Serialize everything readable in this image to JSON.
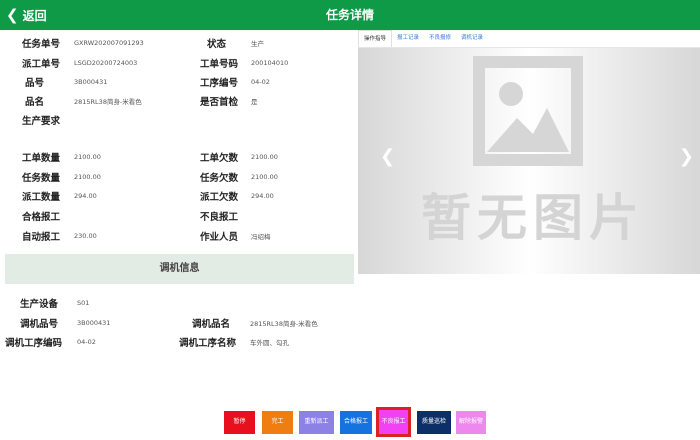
{
  "header": {
    "back_label": "返回",
    "title": "任务详情"
  },
  "fields": [
    {
      "label": "任务单号",
      "value": "GXRW202007091293"
    },
    {
      "label": "状态",
      "value": "生产"
    },
    {
      "label": "派工单号",
      "value": "LSGD20200724003"
    },
    {
      "label": "工单号码",
      "value": "200104010"
    },
    {
      "label": "品号",
      "value": "3B000431"
    },
    {
      "label": "工序编号",
      "value": "04-02"
    },
    {
      "label": "品名",
      "value": "2815RL38简身-米看色"
    },
    {
      "label": "是否首检",
      "value": "是"
    },
    {
      "label": "生产要求",
      "value": ""
    },
    {
      "label": "工单数量",
      "value": "2100.00"
    },
    {
      "label": "工单欠数",
      "value": "2100.00"
    },
    {
      "label": "任务数量",
      "value": "2100.00"
    },
    {
      "label": "任务欠数",
      "value": "2100.00"
    },
    {
      "label": "派工数量",
      "value": "294.00"
    },
    {
      "label": "派工欠数",
      "value": "294.00"
    },
    {
      "label": "合格报工",
      "value": ""
    },
    {
      "label": "不良报工",
      "value": ""
    },
    {
      "label": "自动报工",
      "value": "230.00"
    },
    {
      "label": "作业人员",
      "value": "冯绍梅"
    }
  ],
  "section_title": "调机信息",
  "adjust_fields": [
    {
      "label": "生产设备",
      "value": "S01"
    },
    {
      "label": "调机品号",
      "value": "3B000431"
    },
    {
      "label": "调机品名",
      "value": "2815RL38简身-米看色"
    },
    {
      "label": "调机工序编码",
      "value": "04-02"
    },
    {
      "label": "调机工序名称",
      "value": "车外圆、勾孔"
    }
  ],
  "media": {
    "tabs": [
      "操作指导",
      "报工记录",
      "不良报修",
      "调机记录"
    ],
    "active_tab": 0,
    "placeholder_text": "暂无图片",
    "prev_icon": "chevron-left-icon",
    "next_icon": "chevron-right-icon"
  },
  "buttons": [
    {
      "label": "暂停",
      "color": "#e8101f"
    },
    {
      "label": "完工",
      "color": "#f07d10"
    },
    {
      "label": "重新派工",
      "color": "#8c82e6"
    },
    {
      "label": "合格报工",
      "color": "#1572de"
    },
    {
      "label": "不良报工",
      "color": "#f241f5"
    },
    {
      "label": "质量巡检",
      "color": "#0d2f67"
    },
    {
      "label": "解除报警",
      "color": "#ee87ee"
    }
  ],
  "colors": {
    "header": "#0f9a47",
    "section_bar": "#e3ebe5"
  }
}
